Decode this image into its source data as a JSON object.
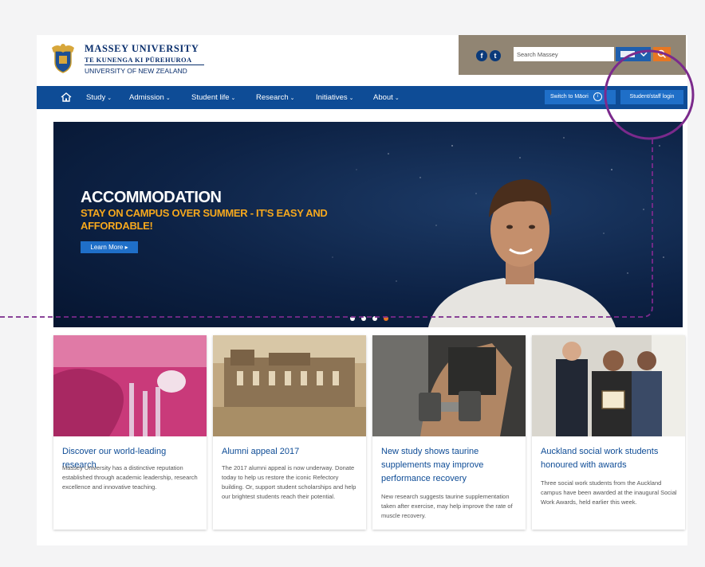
{
  "brand": {
    "line1": "MASSEY UNIVERSITY",
    "line2": "TE KUNENGA KI PŪREHUROA",
    "line3": "UNIVERSITY OF NEW ZEALAND"
  },
  "header": {
    "search_placeholder": "Search Massey",
    "social": [
      {
        "icon": "facebook-icon",
        "glyph": "f"
      },
      {
        "icon": "twitter-icon",
        "glyph": "t"
      }
    ]
  },
  "nav": {
    "items": [
      {
        "label": "Study"
      },
      {
        "label": "Admission"
      },
      {
        "label": "Student life"
      },
      {
        "label": "Research"
      },
      {
        "label": "Initiatives"
      },
      {
        "label": "About"
      }
    ],
    "maori_label": "Switch to Māori",
    "login_label": "Student/staff login"
  },
  "hero": {
    "title": "ACCOMMODATION",
    "subtitle": "STAY ON CAMPUS OVER SUMMER - IT'S EASY AND AFFORDABLE!",
    "cta_label": "Learn More",
    "slides_total": 4,
    "active_slide": 4
  },
  "cards": [
    {
      "title": "Discover our world-leading research",
      "body": "Massey University has a distinctive reputation established through academic leadership, research excellence and innovative teaching."
    },
    {
      "title": "Alumni appeal 2017",
      "body": "The 2017 alumni appeal is now underway. Donate today to help us restore the iconic Refectory building. Or, support student scholarships and help our brightest students reach their potential."
    },
    {
      "title": "New study shows taurine supplements may improve performance recovery",
      "body": "New research suggests taurine supplementation taken after exercise, may help improve the rate of muscle recovery."
    },
    {
      "title": "Auckland social work students honoured with awards",
      "body": "Three social work students from the Auckland campus have been awarded at the inaugural Social Work Awards, held earlier this week."
    }
  ],
  "colors": {
    "nav_blue": "#0e4c96",
    "button_blue": "#1f6fc8",
    "accent_orange": "#e87722",
    "hero_yellow": "#f6a81d",
    "annotation_purple": "#7b2a8c"
  }
}
